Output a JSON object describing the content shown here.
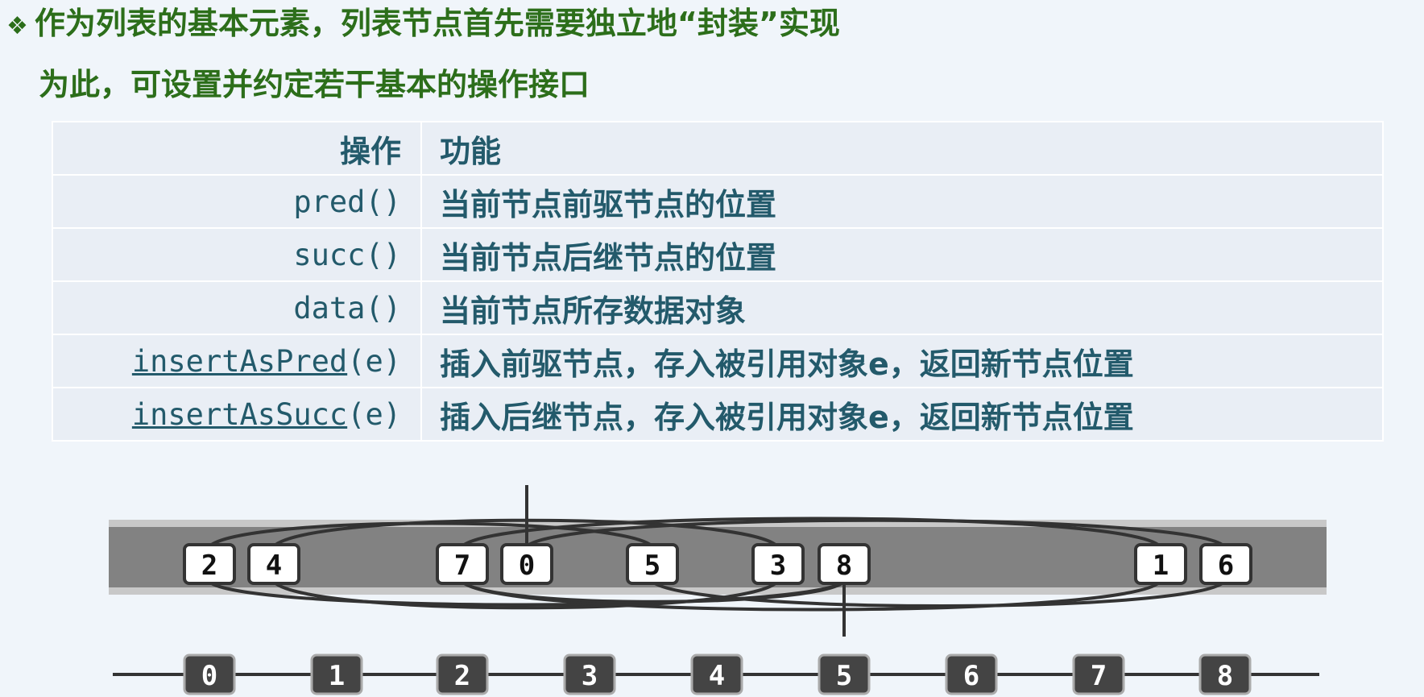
{
  "heading": {
    "bullet": "❖",
    "line1": "作为列表的基本元素，列表节点首先需要独立地“封装”实现",
    "line2": "为此，可设置并约定若干基本的操作接口"
  },
  "table": {
    "header": {
      "op": "操作",
      "fn": "功能"
    },
    "rows": [
      {
        "op_main": "",
        "op_tail": "pred()",
        "fn": "当前节点前驱节点的位置"
      },
      {
        "op_main": "",
        "op_tail": "succ()",
        "fn": "当前节点后继节点的位置"
      },
      {
        "op_main": "",
        "op_tail": "data()",
        "fn": "当前节点所存数据对象"
      },
      {
        "op_main": "insertAsPred",
        "op_tail": "(e)",
        "fn": "插入前驱节点，存入被引用对象e，返回新节点位置"
      },
      {
        "op_main": "insertAsSucc",
        "op_tail": "(e)",
        "fn": "插入后继节点，存入被引用对象e，返回新节点位置"
      }
    ]
  },
  "diagram": {
    "memory_nodes": [
      "2",
      "4",
      "7",
      "0",
      "5",
      "3",
      "8",
      "1",
      "6"
    ],
    "rank_nodes": [
      "0",
      "1",
      "2",
      "3",
      "4",
      "5",
      "6",
      "7",
      "8"
    ]
  }
}
